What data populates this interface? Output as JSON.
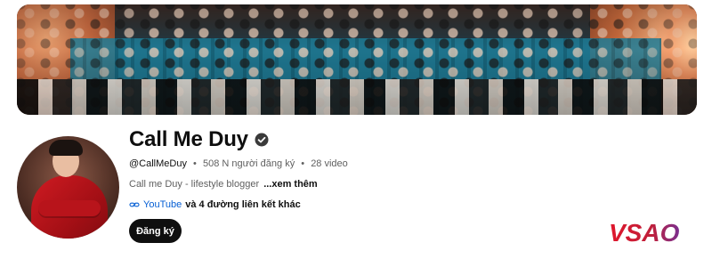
{
  "channel": {
    "name": "Call Me Duy",
    "handle": "@CallMeDuy",
    "subscribers": "508 N người đăng ký",
    "separator": "•",
    "videos": "28 video",
    "description": "Call me Duy -  lifestyle blogger",
    "more_label": "...xem thêm",
    "link_primary": "YouTube",
    "link_others": "và 4 đường liên kết khác",
    "subscribe_label": "Đăng ký"
  },
  "watermark": {
    "text": "VSAO"
  },
  "colors": {
    "link_blue": "#065fd4",
    "button_bg": "#0f0f0f",
    "text_secondary": "#606060",
    "watermark_red": "#e0162b",
    "watermark_purple": "#7a2f8f"
  },
  "icons": {
    "verified": "verified-check-icon",
    "link": "link-icon"
  }
}
